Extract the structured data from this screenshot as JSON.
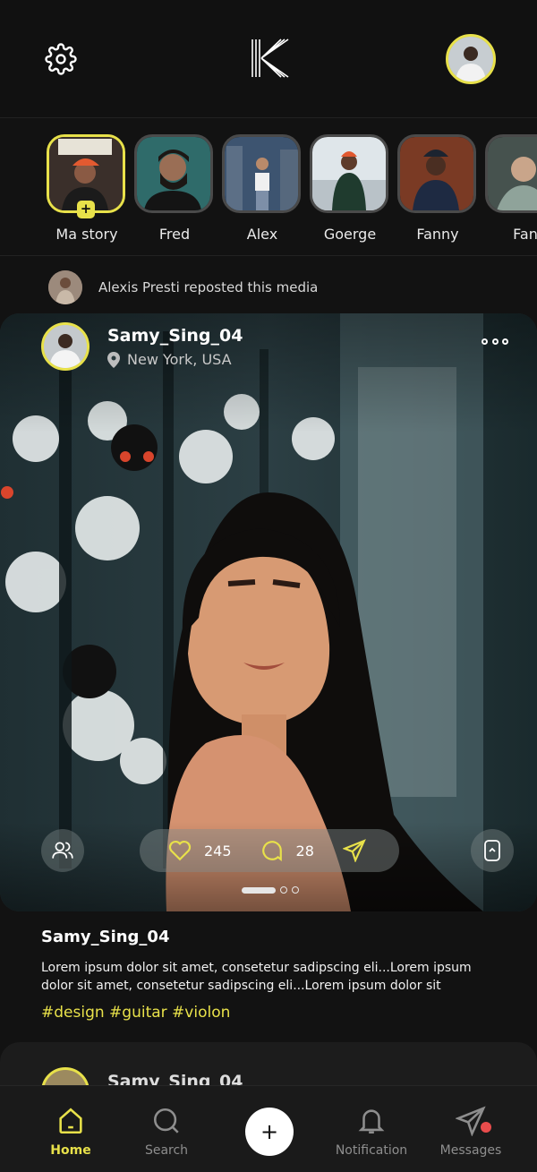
{
  "header": {
    "settings_icon": "gear-icon",
    "logo": "K-logo",
    "profile_icon": "avatar"
  },
  "stories": [
    {
      "name": "Ma story",
      "own": true
    },
    {
      "name": "Fred"
    },
    {
      "name": "Alex"
    },
    {
      "name": "Goerge"
    },
    {
      "name": "Fanny"
    },
    {
      "name": "Fan"
    }
  ],
  "repost": {
    "text": "Alexis Presti reposted this media"
  },
  "post": {
    "username": "Samy_Sing_04",
    "location": "New York, USA",
    "likes": "245",
    "comments": "28",
    "caption_user": "Samy_Sing_04",
    "caption": "Lorem ipsum dolor sit amet, consetetur sadipscing eli...Lorem ipsum dolor sit amet, consetetur sadipscing eli...Lorem ipsum dolor sit",
    "tags": "#design #guitar #violon"
  },
  "next_post": {
    "username": "Samy_Sing_04"
  },
  "tabbar": {
    "home": "Home",
    "search": "Search",
    "add": "+",
    "notification": "Notification",
    "messages": "Messages"
  },
  "colors": {
    "accent": "#e8e14a",
    "background": "#121212",
    "badge": "#e94c4c"
  }
}
